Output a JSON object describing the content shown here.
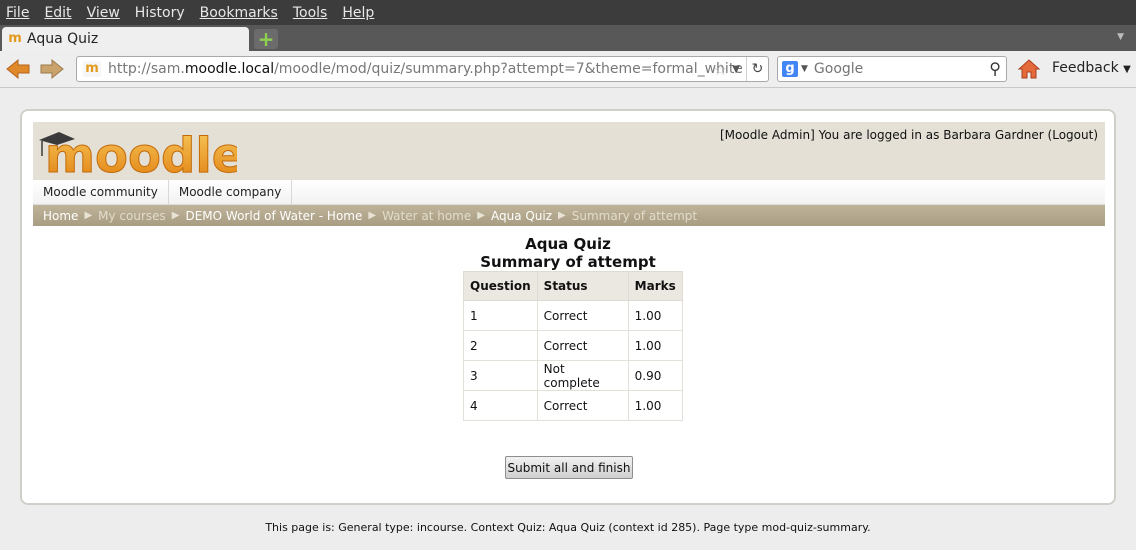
{
  "menubar": {
    "items": [
      "File",
      "Edit",
      "View",
      "History",
      "Bookmarks",
      "Tools",
      "Help"
    ]
  },
  "tabs": {
    "active_title": "Aqua Quiz"
  },
  "navbar": {
    "url_scheme": "http://sam.",
    "url_host": "moodle.local",
    "url_path": "/moodle/mod/quiz/summary.php?attempt=7&theme=formal_white",
    "search_placeholder": "Google",
    "feedback_label": "Feedback"
  },
  "site": {
    "logo_text": "moodle",
    "login_info": "[Moodle Admin] You are logged in as Barbara Gardner (Logout)",
    "custom_menu": [
      "Moodle community",
      "Moodle company"
    ],
    "breadcrumb": [
      {
        "label": "Home",
        "dim": false
      },
      {
        "label": "My courses",
        "dim": true
      },
      {
        "label": "DEMO World of Water - Home",
        "dim": false
      },
      {
        "label": "Water at home",
        "dim": true
      },
      {
        "label": "Aqua Quiz",
        "dim": false
      },
      {
        "label": "Summary of attempt",
        "dim": true
      }
    ]
  },
  "main": {
    "quiz_title": "Aqua Quiz",
    "subtitle": "Summary of attempt",
    "table": {
      "headers": [
        "Question",
        "Status",
        "Marks"
      ],
      "rows": [
        [
          "1",
          "Correct",
          "1.00"
        ],
        [
          "2",
          "Correct",
          "1.00"
        ],
        [
          "3",
          "Not complete",
          "0.90"
        ],
        [
          "4",
          "Correct",
          "1.00"
        ]
      ]
    },
    "submit_label": "Submit all and finish"
  },
  "footer": {
    "text": "This page is: General type: incourse. Context Quiz: Aqua Quiz (context id 285). Page type mod-quiz-summary."
  },
  "colors": {
    "header_bg": "#e4e0d6",
    "breadcrumb_bg": "#b3a88d",
    "logo_orange": "#f0981c"
  },
  "icons": [
    "back-arrow-icon",
    "forward-arrow-icon",
    "bookmark-star-icon",
    "reload-icon",
    "search-magnifier-icon",
    "home-icon",
    "new-tab-icon"
  ]
}
